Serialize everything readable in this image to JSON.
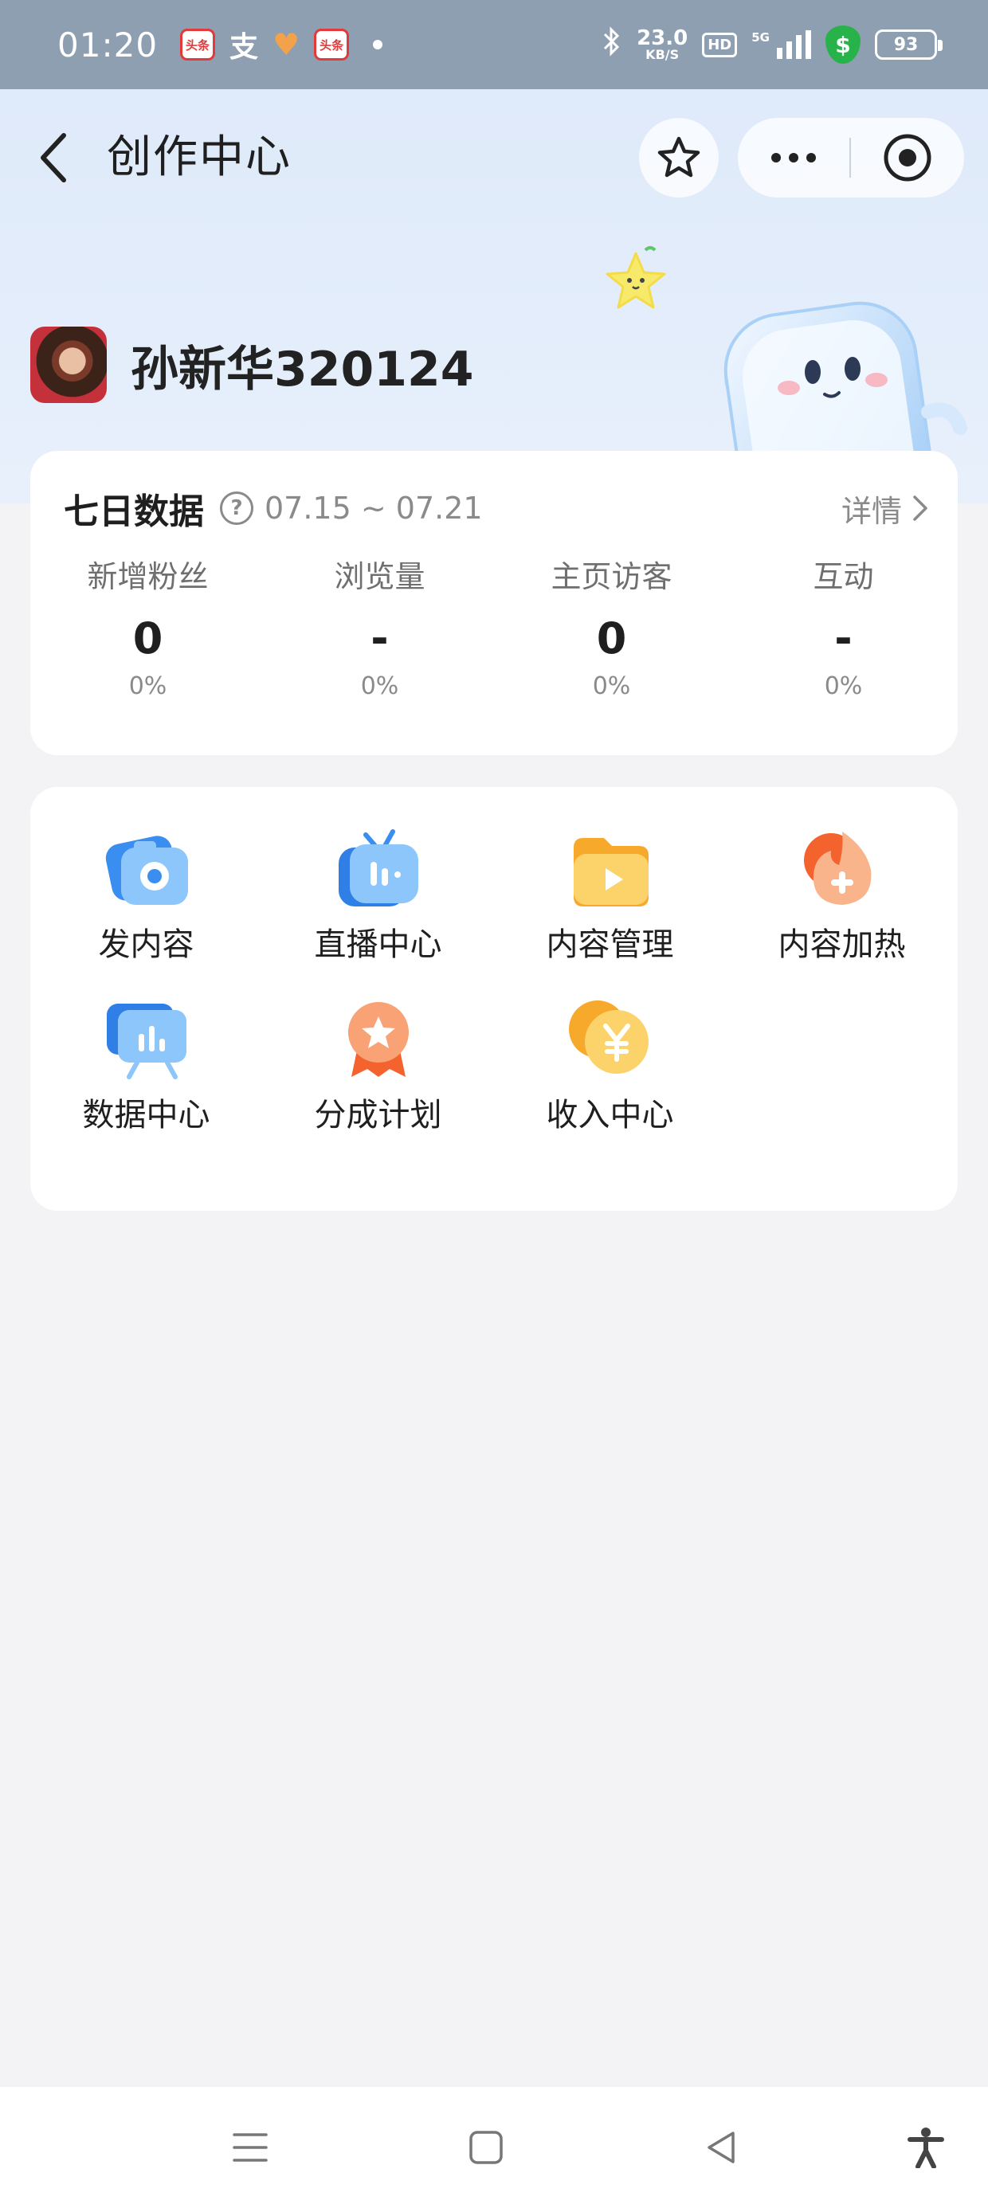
{
  "status_bar": {
    "time": "01:20",
    "app_badge_1": "头条",
    "app_badge_2": "头条",
    "alipay_glyph": "支",
    "heart_glyph": "♥",
    "network_speed": "23.0",
    "network_unit": "KB/S",
    "hd": "HD",
    "network_type": "5G",
    "shield": "$",
    "battery": "93"
  },
  "header": {
    "title": "创作中心"
  },
  "profile": {
    "username": "孙新华320124"
  },
  "stats": {
    "title": "七日数据",
    "help": "?",
    "date_range": "07.15 ~ 07.21",
    "detail_label": "详情",
    "metrics": [
      {
        "label": "新增粉丝",
        "value": "0",
        "change": "0%"
      },
      {
        "label": "浏览量",
        "value": "-",
        "change": "0%"
      },
      {
        "label": "主页访客",
        "value": "0",
        "change": "0%"
      },
      {
        "label": "互动",
        "value": "-",
        "change": "0%"
      }
    ]
  },
  "tools": [
    {
      "label": "发内容",
      "icon": "camera-icon"
    },
    {
      "label": "直播中心",
      "icon": "tv-icon"
    },
    {
      "label": "内容管理",
      "icon": "folder-play-icon"
    },
    {
      "label": "内容加热",
      "icon": "flame-plus-icon"
    },
    {
      "label": "数据中心",
      "icon": "chart-board-icon"
    },
    {
      "label": "分成计划",
      "icon": "medal-icon"
    },
    {
      "label": "收入中心",
      "icon": "yuan-coin-icon"
    }
  ],
  "colors": {
    "hero_bg": "#e3edfb",
    "status_bar_bg": "#8d9fb0",
    "page_bg": "#f3f3f5",
    "blue_accent": "#3a8ef0",
    "orange_accent": "#f47a3c",
    "yellow_accent": "#f7b52c"
  }
}
